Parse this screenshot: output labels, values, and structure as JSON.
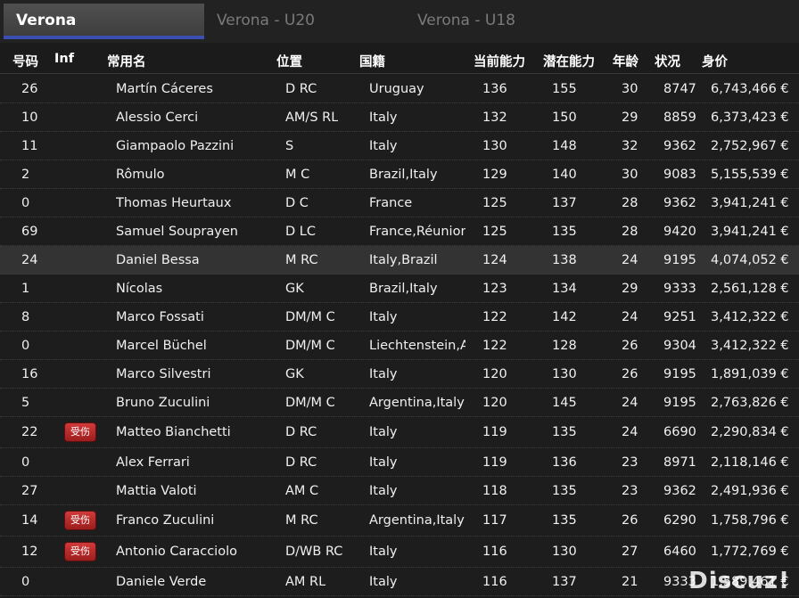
{
  "tabs": [
    {
      "label": "Verona",
      "active": true
    },
    {
      "label": "Verona - U20",
      "active": false
    },
    {
      "label": "Verona - U18",
      "active": false
    }
  ],
  "columns": {
    "num": "号码",
    "inf": "Inf",
    "name": "常用名",
    "pos": "位置",
    "nat": "国籍",
    "ca": "当前能力",
    "pa": "潜在能力",
    "age": "年龄",
    "cond": "状况",
    "val": "身价"
  },
  "players": [
    {
      "num": "26",
      "inf": "",
      "name": "Martín Cáceres",
      "pos": "D RC",
      "nat": "Uruguay",
      "ca": "136",
      "pa": "155",
      "age": "30",
      "cond": "8747",
      "val": "6,743,466 €"
    },
    {
      "num": "10",
      "inf": "",
      "name": "Alessio Cerci",
      "pos": "AM/S RL",
      "nat": "Italy",
      "ca": "132",
      "pa": "150",
      "age": "29",
      "cond": "8859",
      "val": "6,373,423 €"
    },
    {
      "num": "11",
      "inf": "",
      "name": "Giampaolo Pazzini",
      "pos": "S",
      "nat": "Italy",
      "ca": "130",
      "pa": "148",
      "age": "32",
      "cond": "9362",
      "val": "2,752,967 €"
    },
    {
      "num": "2",
      "inf": "",
      "name": "Rômulo",
      "pos": "M C",
      "nat": "Brazil,Italy",
      "ca": "129",
      "pa": "140",
      "age": "30",
      "cond": "9083",
      "val": "5,155,539 €"
    },
    {
      "num": "0",
      "inf": "",
      "name": "Thomas Heurtaux",
      "pos": "D C",
      "nat": "France",
      "ca": "125",
      "pa": "137",
      "age": "28",
      "cond": "9362",
      "val": "3,941,241 €"
    },
    {
      "num": "69",
      "inf": "",
      "name": "Samuel Souprayen",
      "pos": "D LC",
      "nat": "France,Réunion",
      "ca": "125",
      "pa": "135",
      "age": "28",
      "cond": "9420",
      "val": "3,941,241 €"
    },
    {
      "num": "24",
      "inf": "",
      "name": "Daniel Bessa",
      "pos": "M RC",
      "nat": "Italy,Brazil",
      "ca": "124",
      "pa": "138",
      "age": "24",
      "cond": "9195",
      "val": "4,074,052 €",
      "selected": true
    },
    {
      "num": "1",
      "inf": "",
      "name": "Nícolas",
      "pos": "GK",
      "nat": "Brazil,Italy",
      "ca": "123",
      "pa": "134",
      "age": "29",
      "cond": "9333",
      "val": "2,561,128 €"
    },
    {
      "num": "8",
      "inf": "",
      "name": "Marco Fossati",
      "pos": "DM/M C",
      "nat": "Italy",
      "ca": "122",
      "pa": "142",
      "age": "24",
      "cond": "9251",
      "val": "3,412,322 €"
    },
    {
      "num": "0",
      "inf": "",
      "name": "Marcel Büchel",
      "pos": "DM/M C",
      "nat": "Liechtenstein,A",
      "ca": "122",
      "pa": "128",
      "age": "26",
      "cond": "9304",
      "val": "3,412,322 €"
    },
    {
      "num": "16",
      "inf": "",
      "name": "Marco Silvestri",
      "pos": "GK",
      "nat": "Italy",
      "ca": "120",
      "pa": "130",
      "age": "26",
      "cond": "9195",
      "val": "1,891,039 €"
    },
    {
      "num": "5",
      "inf": "",
      "name": "Bruno Zuculini",
      "pos": "DM/M C",
      "nat": "Argentina,Italy",
      "ca": "120",
      "pa": "145",
      "age": "24",
      "cond": "9195",
      "val": "2,763,826 €"
    },
    {
      "num": "22",
      "inf": "受伤",
      "name": "Matteo Bianchetti",
      "pos": "D RC",
      "nat": "Italy",
      "ca": "119",
      "pa": "135",
      "age": "24",
      "cond": "6690",
      "val": "2,290,834 €"
    },
    {
      "num": "0",
      "inf": "",
      "name": "Alex Ferrari",
      "pos": "D RC",
      "nat": "Italy",
      "ca": "119",
      "pa": "136",
      "age": "23",
      "cond": "8971",
      "val": "2,118,146 €"
    },
    {
      "num": "27",
      "inf": "",
      "name": "Mattia Valoti",
      "pos": "AM C",
      "nat": "Italy",
      "ca": "118",
      "pa": "135",
      "age": "23",
      "cond": "9362",
      "val": "2,491,936 €"
    },
    {
      "num": "14",
      "inf": "受伤",
      "name": "Franco Zuculini",
      "pos": "M RC",
      "nat": "Argentina,Italy",
      "ca": "117",
      "pa": "135",
      "age": "26",
      "cond": "6290",
      "val": "1,758,796 €"
    },
    {
      "num": "12",
      "inf": "受伤",
      "name": "Antonio Caracciolo",
      "pos": "D/WB RC",
      "nat": "Italy",
      "ca": "116",
      "pa": "130",
      "age": "27",
      "cond": "6460",
      "val": "1,772,769 €"
    },
    {
      "num": "0",
      "inf": "",
      "name": "Daniele Verde",
      "pos": "AM RL",
      "nat": "Italy",
      "ca": "116",
      "pa": "137",
      "age": "21",
      "cond": "9333",
      "val": "1,589,461 €"
    }
  ],
  "watermark": "Discuz!"
}
